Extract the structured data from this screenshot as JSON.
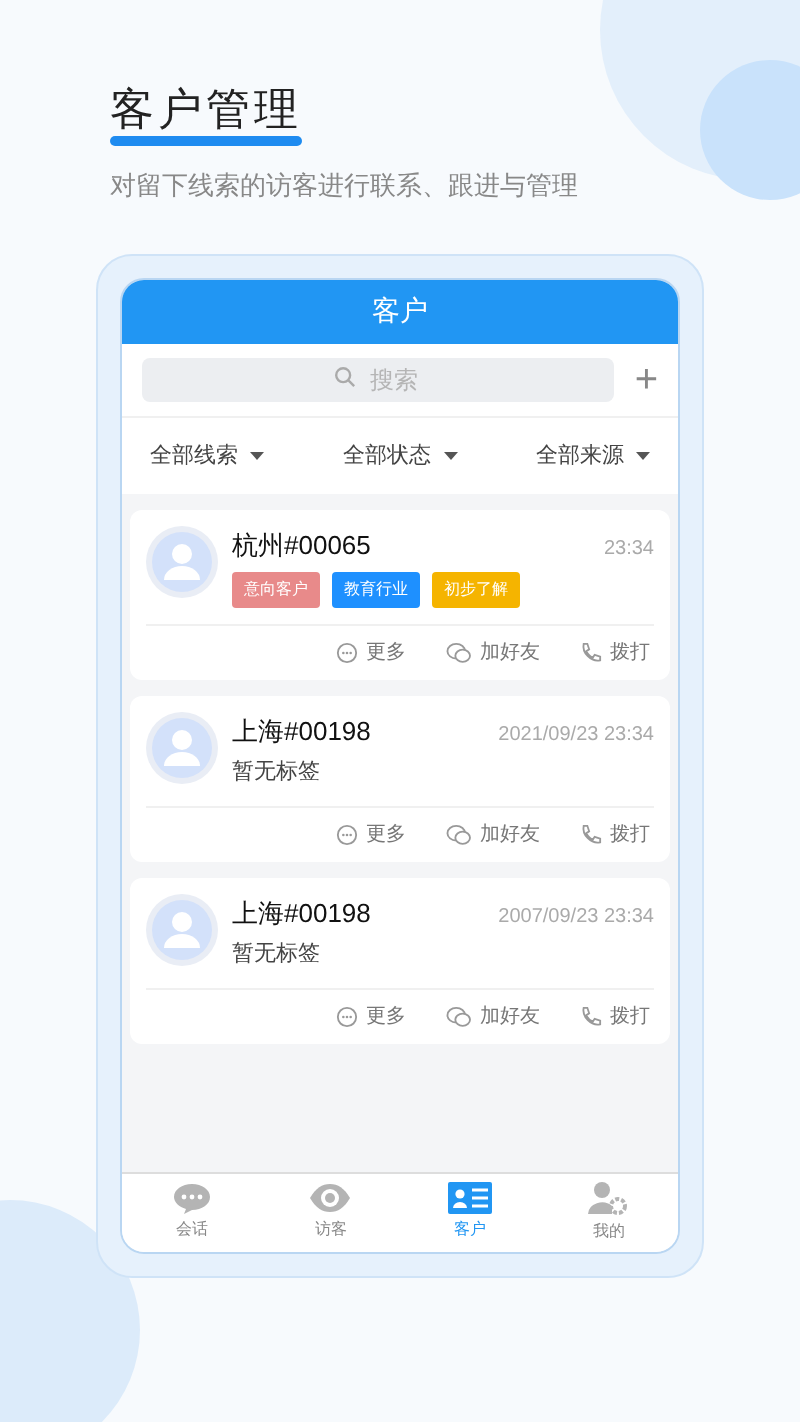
{
  "promo": {
    "title": "客户管理",
    "subtitle": "对留下线索的访客进行联系、跟进与管理"
  },
  "screen": {
    "title": "客户",
    "search": {
      "placeholder": "搜索"
    },
    "add_button": "+",
    "filters": [
      {
        "label": "全部线索"
      },
      {
        "label": "全部状态"
      },
      {
        "label": "全部来源"
      }
    ],
    "customers": [
      {
        "name": "杭州#00065",
        "time": "23:34",
        "tags": [
          {
            "label": "意向客户",
            "color": "#e88a8a"
          },
          {
            "label": "教育行业",
            "color": "#1e90ff"
          },
          {
            "label": "初步了解",
            "color": "#f5b400"
          }
        ],
        "actions": [
          "更多",
          "加好友",
          "拨打"
        ]
      },
      {
        "name": "上海#00198",
        "time": "2021/09/23 23:34",
        "no_tags_text": "暂无标签",
        "actions": [
          "更多",
          "加好友",
          "拨打"
        ]
      },
      {
        "name": "上海#00198",
        "time": "2007/09/23 23:34",
        "no_tags_text": "暂无标签",
        "actions": [
          "更多",
          "加好友",
          "拨打"
        ]
      }
    ],
    "tabbar": [
      {
        "label": "会话",
        "selected": false
      },
      {
        "label": "访客",
        "selected": false
      },
      {
        "label": "客户",
        "selected": true
      },
      {
        "label": "我的",
        "selected": false
      }
    ]
  }
}
